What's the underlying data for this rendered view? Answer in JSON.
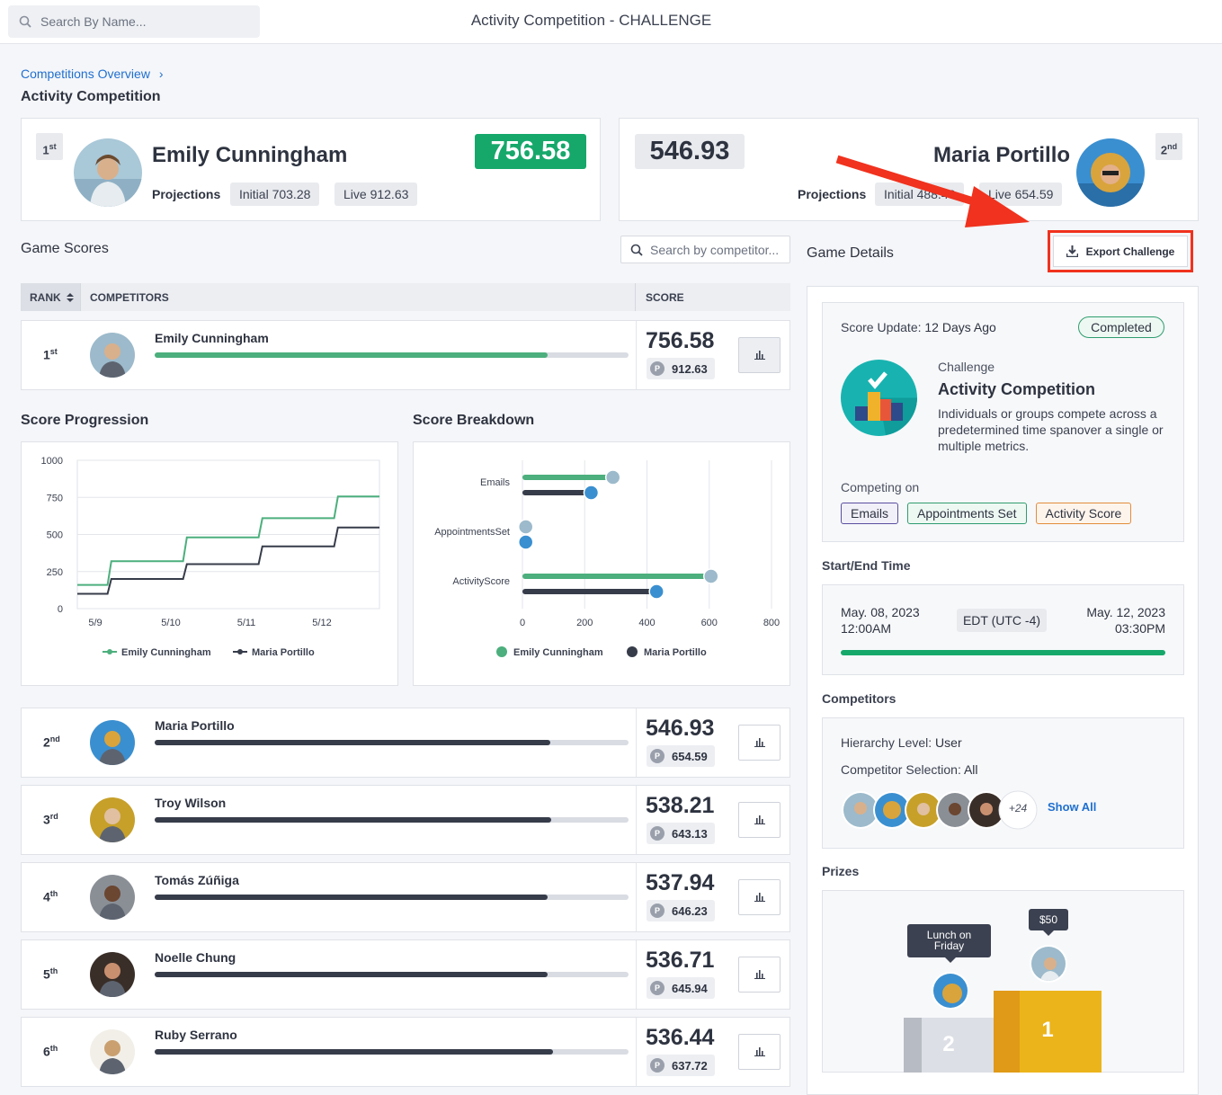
{
  "header": {
    "search_placeholder": "Search By Name...",
    "title": "Activity Competition - CHALLENGE"
  },
  "breadcrumb": {
    "link": "Competitions Overview",
    "separator": "›",
    "current": "Activity Competition"
  },
  "leader_cards": {
    "first": {
      "rank_num": "1",
      "rank_suffix": "st",
      "name": "Emily Cunningham",
      "score": "756.58",
      "projections_label": "Projections",
      "initial": "Initial 703.28",
      "live": "Live 912.63"
    },
    "second": {
      "rank_num": "2",
      "rank_suffix": "nd",
      "name": "Maria Portillo",
      "score": "546.93",
      "projections_label": "Projections",
      "initial": "Initial 488.48",
      "live": "Live 654.59"
    }
  },
  "game_scores": {
    "title": "Game Scores",
    "search_placeholder": "Search by competitor...",
    "columns": {
      "rank": "RANK",
      "competitors": "COMPETITORS",
      "score": "SCORE"
    },
    "sort_icon": "sort-icon",
    "rows": [
      {
        "rank_num": "1",
        "rank_suffix": "st",
        "name": "Emily Cunningham",
        "score": "756.58",
        "projection": "912.63",
        "progress": 0.83,
        "color": "#4caf7d"
      },
      {
        "rank_num": "2",
        "rank_suffix": "nd",
        "name": "Maria Portillo",
        "score": "546.93",
        "projection": "654.59",
        "progress": 0.835,
        "color": "#373c4a"
      },
      {
        "rank_num": "3",
        "rank_suffix": "rd",
        "name": "Troy Wilson",
        "score": "538.21",
        "projection": "643.13",
        "progress": 0.837,
        "color": "#373c4a"
      },
      {
        "rank_num": "4",
        "rank_suffix": "th",
        "name": "Tomás Zúñiga",
        "score": "537.94",
        "projection": "646.23",
        "progress": 0.83,
        "color": "#373c4a"
      },
      {
        "rank_num": "5",
        "rank_suffix": "th",
        "name": "Noelle Chung",
        "score": "536.71",
        "projection": "645.94",
        "progress": 0.83,
        "color": "#373c4a"
      },
      {
        "rank_num": "6",
        "rank_suffix": "th",
        "name": "Ruby Serrano",
        "score": "536.44",
        "projection": "637.72",
        "progress": 0.84,
        "color": "#373c4a"
      }
    ],
    "projection_badge": "P"
  },
  "score_progression": {
    "title": "Score Progression"
  },
  "score_breakdown": {
    "title": "Score Breakdown"
  },
  "chart_data": [
    {
      "type": "line",
      "title": "Score Progression",
      "x": [
        "5/9",
        "5/10",
        "5/11",
        "5/12"
      ],
      "ylim": [
        0,
        1000
      ],
      "yticks": [
        0,
        250,
        500,
        750,
        1000
      ],
      "grid": true,
      "legend": "bottom",
      "series": [
        {
          "name": "Emily Cunningham",
          "color": "#4caf7d",
          "steps": [
            [
              0,
              160
            ],
            [
              0.4,
              160
            ],
            [
              0.45,
              320
            ],
            [
              1.4,
              320
            ],
            [
              1.45,
              480
            ],
            [
              2.4,
              480
            ],
            [
              2.45,
              610
            ],
            [
              3.4,
              610
            ],
            [
              3.45,
              756
            ],
            [
              4.0,
              756
            ]
          ]
        },
        {
          "name": "Maria Portillo",
          "color": "#373c4a",
          "steps": [
            [
              0,
              100
            ],
            [
              0.4,
              100
            ],
            [
              0.45,
              200
            ],
            [
              1.4,
              200
            ],
            [
              1.45,
              300
            ],
            [
              2.4,
              300
            ],
            [
              2.45,
              420
            ],
            [
              3.4,
              420
            ],
            [
              3.45,
              547
            ],
            [
              4.0,
              547
            ]
          ]
        }
      ]
    },
    {
      "type": "bar",
      "orientation": "horizontal",
      "title": "Score Breakdown",
      "categories": [
        "Emails",
        "AppointmentsSet",
        "ActivityScore"
      ],
      "xlim": [
        0,
        800
      ],
      "xticks": [
        0,
        200,
        400,
        600,
        800
      ],
      "legend": "bottom",
      "series": [
        {
          "name": "Emily Cunningham",
          "color": "#4caf7d",
          "values": [
            285,
            5,
            600
          ]
        },
        {
          "name": "Maria Portillo",
          "color": "#373c4a",
          "values": [
            215,
            5,
            425
          ]
        }
      ]
    }
  ],
  "game_details": {
    "title": "Game Details",
    "export_label": "Export Challenge",
    "score_update_label": "Score Update:",
    "score_update_value": "12 Days Ago",
    "status": "Completed",
    "challenge_label": "Challenge",
    "challenge_name": "Activity Competition",
    "challenge_desc": "Individuals or groups compete across a predetermined time spanover a single or multiple metrics.",
    "competing_on_label": "Competing on",
    "metrics": [
      {
        "label": "Emails",
        "color": "#5a4fa0",
        "bg": "#f1f0f8"
      },
      {
        "label": "Appointments Set",
        "color": "#2e9d6f",
        "bg": "#eef8f3"
      },
      {
        "label": "Activity Score",
        "color": "#e38d3c",
        "bg": "#fdf4ec"
      }
    ],
    "start_end_label": "Start/End Time",
    "start_date": "May. 08, 2023",
    "start_time": "12:00AM",
    "timezone": "EDT (UTC -4)",
    "end_date": "May. 12, 2023",
    "end_time": "03:30PM",
    "time_progress": 1.0,
    "competitors_label": "Competitors",
    "hierarchy_label": "Hierarchy Level:",
    "hierarchy_value": "User",
    "selection_label": "Competitor Selection:",
    "selection_value": "All",
    "more_count": "+24",
    "show_all": "Show All",
    "prizes_label": "Prizes",
    "prize_second": "Lunch on Friday",
    "prize_first": "$50",
    "podium_second": "2",
    "podium_first": "1"
  },
  "annotation": {
    "arrow_color": "#f0321e",
    "highlight_color": "#f0321e"
  }
}
